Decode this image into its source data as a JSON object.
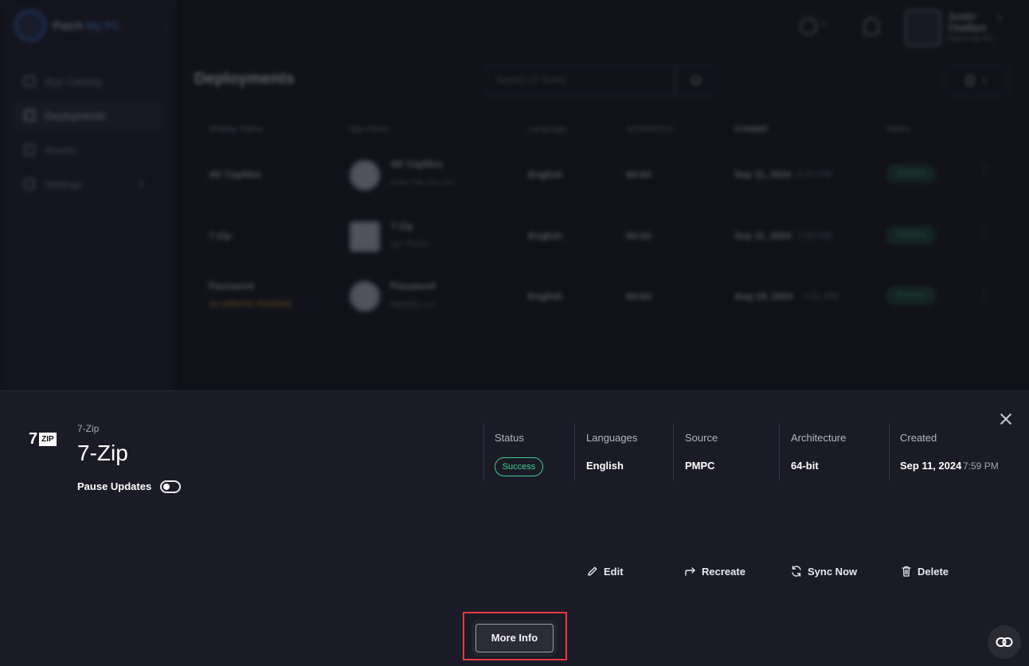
{
  "background": {
    "brand": {
      "name": "Patch",
      "accent": "My PC"
    },
    "nav": [
      {
        "label": "App Catalog",
        "active": false
      },
      {
        "label": "Deployments",
        "active": true
      },
      {
        "label": "Assets",
        "active": false
      },
      {
        "label": "Settings",
        "active": false
      }
    ],
    "user": {
      "name": "Justin Chalfant",
      "sub": "Patch My PC"
    },
    "page_title": "Deployments",
    "search_placeholder": "Search (3 Items)",
    "table": {
      "headers": [
        "Display Name",
        "App Name",
        "Language",
        "Architecture",
        "Created",
        "Status"
      ],
      "rows": [
        {
          "display": "All 7zipfiles",
          "app": "All 7zipfiles",
          "vendor": "www.7zip.org.com",
          "language": "English",
          "arch": "64-bit",
          "date": "Sep 11, 2024",
          "time": "8:23 PM",
          "status": "Success",
          "warning": ""
        },
        {
          "display": "7-Zip",
          "app": "7-Zip",
          "vendor": "Igor Pavlov",
          "language": "English",
          "arch": "64-bit",
          "date": "Sep 11, 2024",
          "time": "7:59 PM",
          "status": "Success",
          "warning": ""
        },
        {
          "display": "Password",
          "app": "Password",
          "vendor": "AgileBits Inc",
          "language": "English",
          "arch": "64-bit",
          "date": "Aug 19, 2024",
          "time": "4:41 PM",
          "status": "Success",
          "warning": "An UPDATE PENDING"
        }
      ]
    }
  },
  "panel": {
    "app_logo_text": {
      "seven": "7",
      "zip": "ZIP"
    },
    "app_small_name": "7-Zip",
    "app_title": "7-Zip",
    "pause_updates_label": "Pause Updates",
    "pause_updates_on": false,
    "columns": {
      "status": {
        "label": "Status",
        "value": "Success"
      },
      "languages": {
        "label": "Languages",
        "value": "English"
      },
      "source": {
        "label": "Source",
        "value": "PMPC"
      },
      "architecture": {
        "label": "Architecture",
        "value": "64-bit"
      },
      "created": {
        "label": "Created",
        "date": "Sep 11, 2024",
        "time": "7:59 PM"
      }
    },
    "actions": {
      "edit": "Edit",
      "recreate": "Recreate",
      "sync_now": "Sync Now",
      "delete": "Delete"
    },
    "more_info": "More Info"
  },
  "colors": {
    "success": "#3dcf8e",
    "highlight": "#e23c3c",
    "panel_bg": "#1b1b27"
  }
}
